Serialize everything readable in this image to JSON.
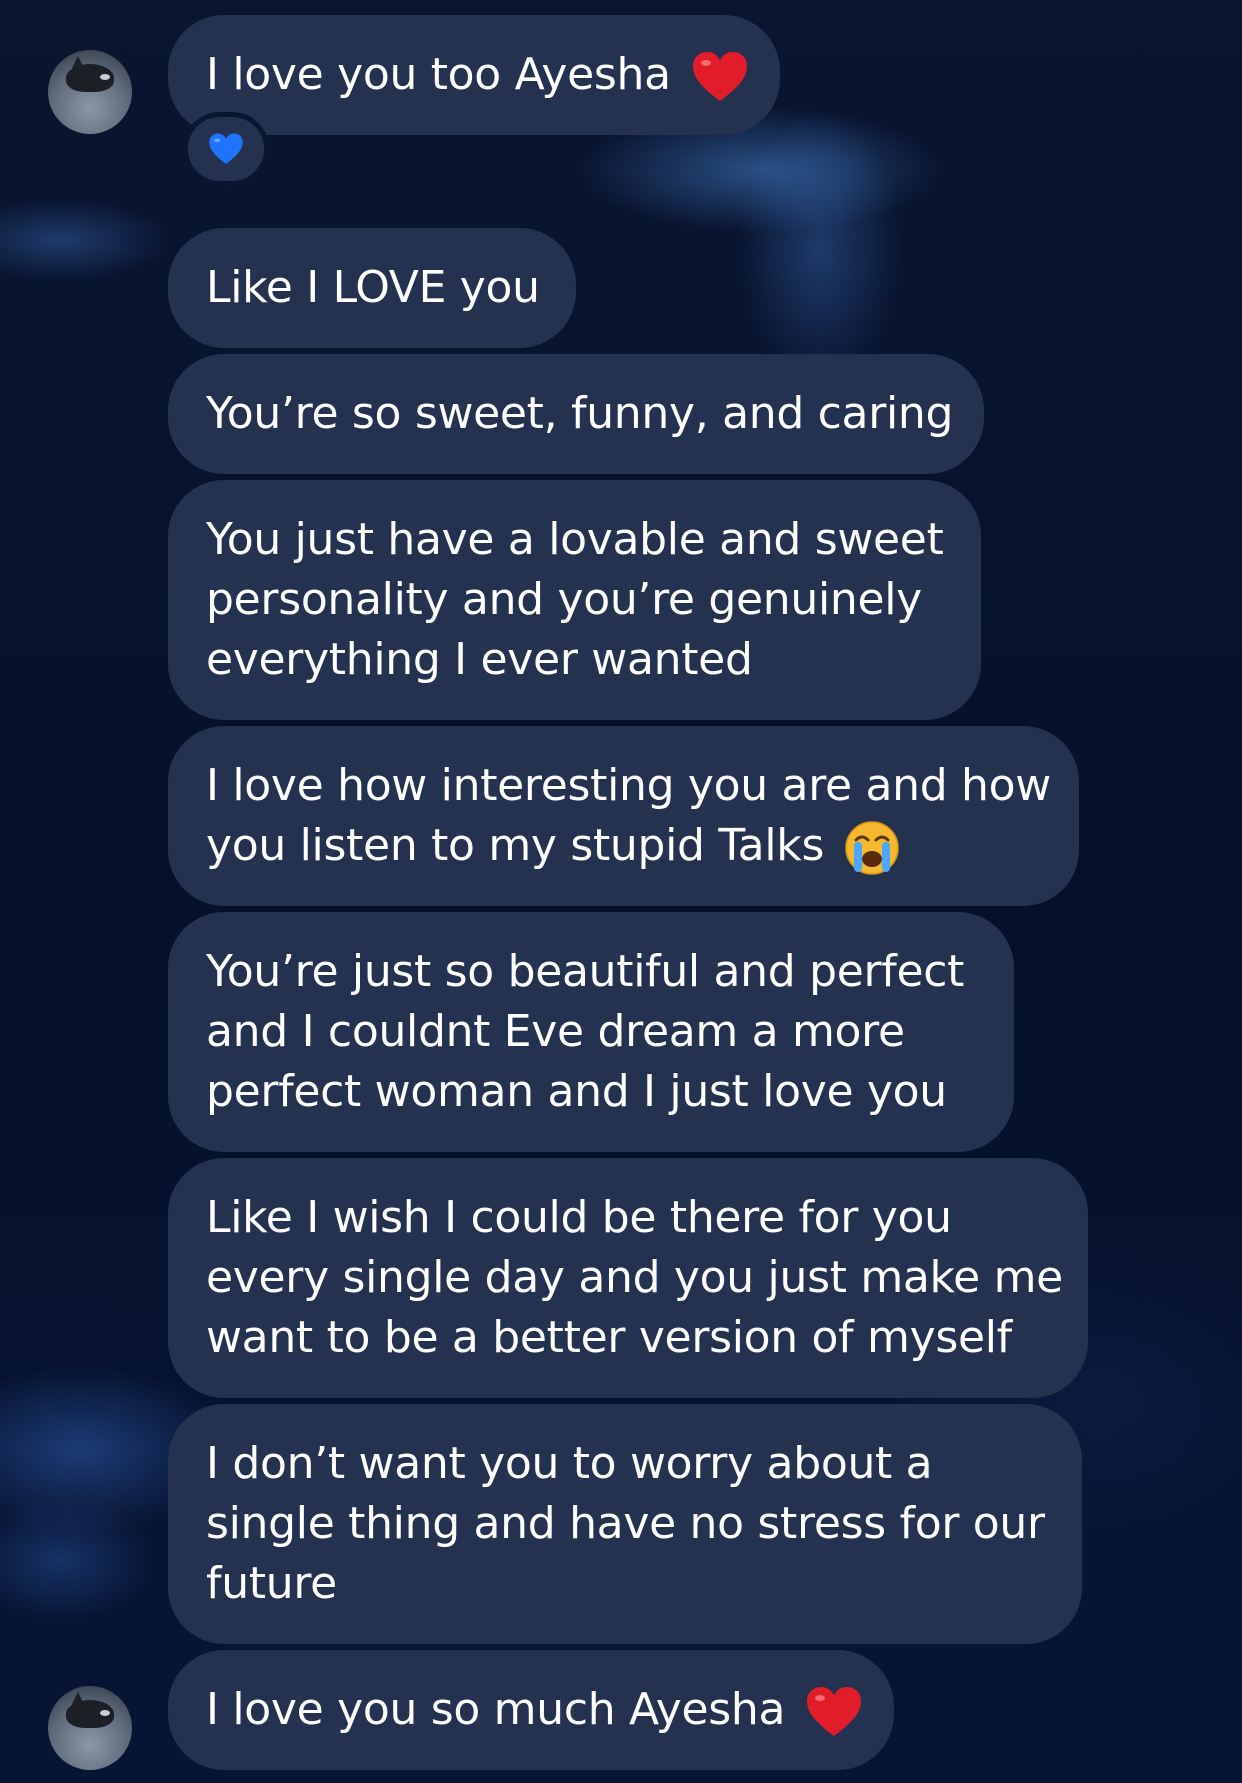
{
  "messages": [
    {
      "text_lines": [
        "I love you too Ayesha"
      ],
      "emoji": "red-heart"
    },
    {
      "text_lines": [
        "Like I LOVE you"
      ]
    },
    {
      "text_lines": [
        "You’re so sweet, funny, and caring"
      ]
    },
    {
      "text_lines": [
        "You just have a lovable and sweet",
        "personality and you’re genuinely",
        "everything I ever wanted"
      ]
    },
    {
      "text_lines": [
        "I love how interesting you are and how",
        "you listen to my stupid Talks"
      ],
      "emoji": "loudly-crying-face"
    },
    {
      "text_lines": [
        "You’re just so beautiful and perfect",
        "and I couldnt Eve dream a more",
        "perfect woman and I just love you"
      ]
    },
    {
      "text_lines": [
        "Like I wish I could be there for you",
        "every single day and you just make me",
        "want to be a better version of myself"
      ]
    },
    {
      "text_lines": [
        "I don’t want you to worry about a",
        "single thing and have no stress for our",
        "future"
      ]
    },
    {
      "text_lines": [
        "I love you so much Ayesha"
      ],
      "emoji": "red-heart"
    }
  ],
  "reaction": {
    "emoji": "blue-heart"
  },
  "colors": {
    "bubble": "#25324f",
    "text": "#ffffff",
    "background": "#07112a",
    "heart_red": "#e11d2a",
    "heart_blue": "#1e74ff"
  }
}
